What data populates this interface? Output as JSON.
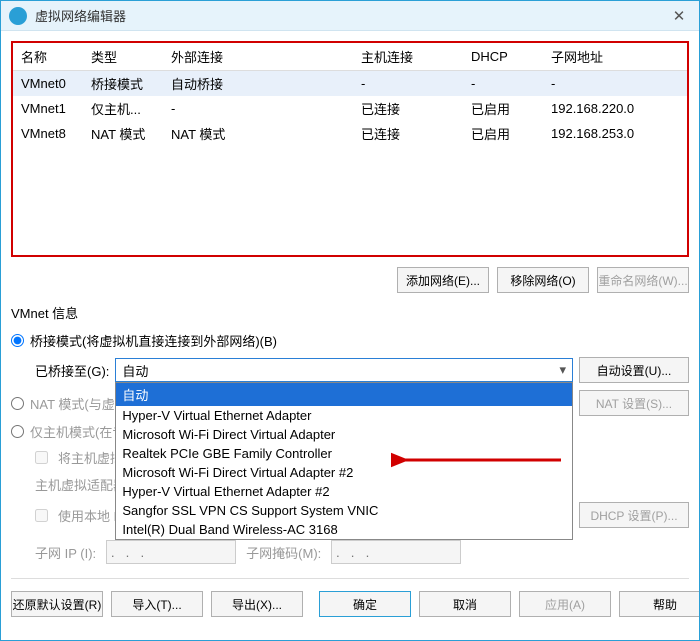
{
  "title": "虚拟网络编辑器",
  "close": "✕",
  "columns": [
    "名称",
    "类型",
    "外部连接",
    "主机连接",
    "DHCP",
    "子网地址"
  ],
  "rows": [
    {
      "name": "VMnet0",
      "type": "桥接模式",
      "ext": "自动桥接",
      "host": "-",
      "dhcp": "-",
      "subnet": "-",
      "selected": true
    },
    {
      "name": "VMnet1",
      "type": "仅主机...",
      "ext": "-",
      "host": "已连接",
      "dhcp": "已启用",
      "subnet": "192.168.220.0",
      "selected": false
    },
    {
      "name": "VMnet8",
      "type": "NAT 模式",
      "ext": "NAT 模式",
      "host": "已连接",
      "dhcp": "已启用",
      "subnet": "192.168.253.0",
      "selected": false
    }
  ],
  "buttons": {
    "add": "添加网络(E)...",
    "remove": "移除网络(O)",
    "rename": "重命名网络(W)...",
    "auto_settings": "自动设置(U)...",
    "nat_settings": "NAT 设置(S)...",
    "dhcp_settings": "DHCP 设置(P)...",
    "restore": "还原默认设置(R)",
    "import": "导入(T)...",
    "export": "导出(X)...",
    "ok": "确定",
    "cancel": "取消",
    "apply": "应用(A)",
    "help": "帮助"
  },
  "section": {
    "heading": "VMnet 信息",
    "bridged_radio": "桥接模式(将虚拟机直接连接到外部网络)(B)",
    "bridged_to": "已桥接至(G):",
    "nat_radio": "NAT 模式(与虚拟机共享主机的 IP 地址)(N)",
    "hostonly_radio": "仅主机模式(在专用网络内连接虚拟机)(H)",
    "connect_host": "将主机虚拟适配器连接到此网络(V)",
    "adapter_name": "主机虚拟适配器名称:",
    "dhcp_check": "使用本地 DHCP 服务将 IP 地址分配给虚拟机(D)",
    "subnet_ip": "子网 IP (I):",
    "subnet_mask": "子网掩码(M):"
  },
  "dropdown": {
    "selected": "自动",
    "options": [
      "自动",
      "Hyper-V Virtual Ethernet Adapter",
      "Microsoft Wi-Fi Direct Virtual Adapter",
      "Realtek PCIe GBE Family Controller",
      "Microsoft Wi-Fi Direct Virtual Adapter #2",
      "Hyper-V Virtual Ethernet Adapter #2",
      "Sangfor SSL VPN CS Support System VNIC",
      "Intel(R) Dual Band Wireless-AC 3168"
    ]
  },
  "ip_placeholder": " .   .   .   "
}
